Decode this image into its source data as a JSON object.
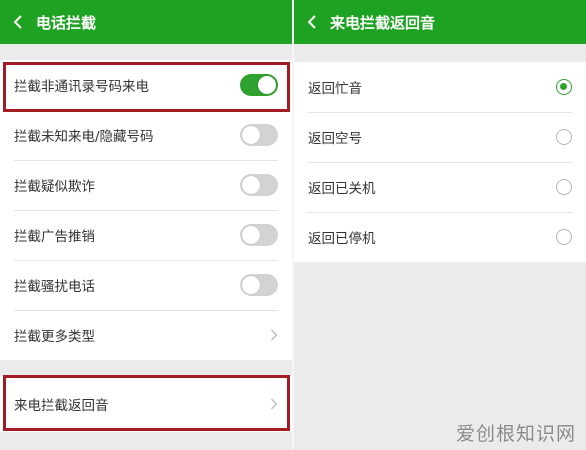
{
  "colors": {
    "header": "#1da321",
    "accent": "#2fa12e",
    "highlight_border": "#a21d23",
    "background": "#ebebeb"
  },
  "left": {
    "title": "电话拦截",
    "back_icon": "chevron-left-icon",
    "items": [
      {
        "label": "拦截非通讯录号码来电",
        "control": "toggle",
        "on": true
      },
      {
        "label": "拦截未知来电/隐藏号码",
        "control": "toggle",
        "on": false
      },
      {
        "label": "拦截疑似欺诈",
        "control": "toggle",
        "on": false
      },
      {
        "label": "拦截广告推销",
        "control": "toggle",
        "on": false
      },
      {
        "label": "拦截骚扰电话",
        "control": "toggle",
        "on": false
      },
      {
        "label": "拦截更多类型",
        "control": "chevron"
      }
    ],
    "return_tone": {
      "label": "来电拦截返回音",
      "control": "chevron"
    }
  },
  "right": {
    "title": "来电拦截返回音",
    "back_icon": "chevron-left-icon",
    "options": [
      {
        "label": "返回忙音",
        "selected": true
      },
      {
        "label": "返回空号",
        "selected": false
      },
      {
        "label": "返回已关机",
        "selected": false
      },
      {
        "label": "返回已停机",
        "selected": false
      }
    ]
  },
  "watermark": "爱创根知识网"
}
